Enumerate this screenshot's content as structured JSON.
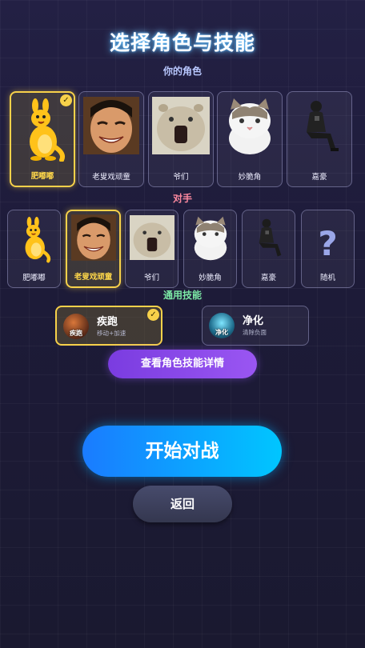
{
  "header": {
    "title": "选择角色与技能"
  },
  "sections": {
    "yours": "你的角色",
    "opponent": "对手",
    "skills": "通用技能"
  },
  "your_characters": [
    {
      "name": "肥嘟嘟",
      "icon": "yellow-kangaroo-icon",
      "selected": true
    },
    {
      "name": "老叟戏顽童",
      "icon": "smiling-man-face-icon",
      "selected": false
    },
    {
      "name": "爷们",
      "icon": "screaming-hamster-icon",
      "selected": false
    },
    {
      "name": "妙脆角",
      "icon": "cat-icon",
      "selected": false
    },
    {
      "name": "嘉豪",
      "icon": "sitting-man-icon",
      "selected": false
    }
  ],
  "opponents": [
    {
      "name": "肥嘟嘟",
      "icon": "yellow-kangaroo-icon",
      "selected": false
    },
    {
      "name": "老叟戏顽童",
      "icon": "smiling-man-face-icon",
      "selected": true
    },
    {
      "name": "爷们",
      "icon": "screaming-hamster-icon",
      "selected": false
    },
    {
      "name": "妙脆角",
      "icon": "cat-icon",
      "selected": false
    },
    {
      "name": "嘉豪",
      "icon": "sitting-man-icon",
      "selected": false
    },
    {
      "name": "随机",
      "icon": "question-mark-icon",
      "selected": false
    }
  ],
  "skills": [
    {
      "name": "疾跑",
      "desc": "移动+加速",
      "icon_label": "疾跑",
      "icon": "sprint-skill-icon",
      "selected": true
    },
    {
      "name": "净化",
      "desc": "清除负面",
      "icon_label": "净化",
      "icon": "purify-skill-icon",
      "selected": false
    }
  ],
  "buttons": {
    "details": "查看角色技能详情",
    "start": "开始对战",
    "back": "返回"
  },
  "colors": {
    "selected_border": "#f7d14a",
    "start_gradient": [
      "#1a7bff",
      "#00c6ff"
    ],
    "details_gradient": [
      "#7a3ce0",
      "#9a56f2"
    ]
  }
}
